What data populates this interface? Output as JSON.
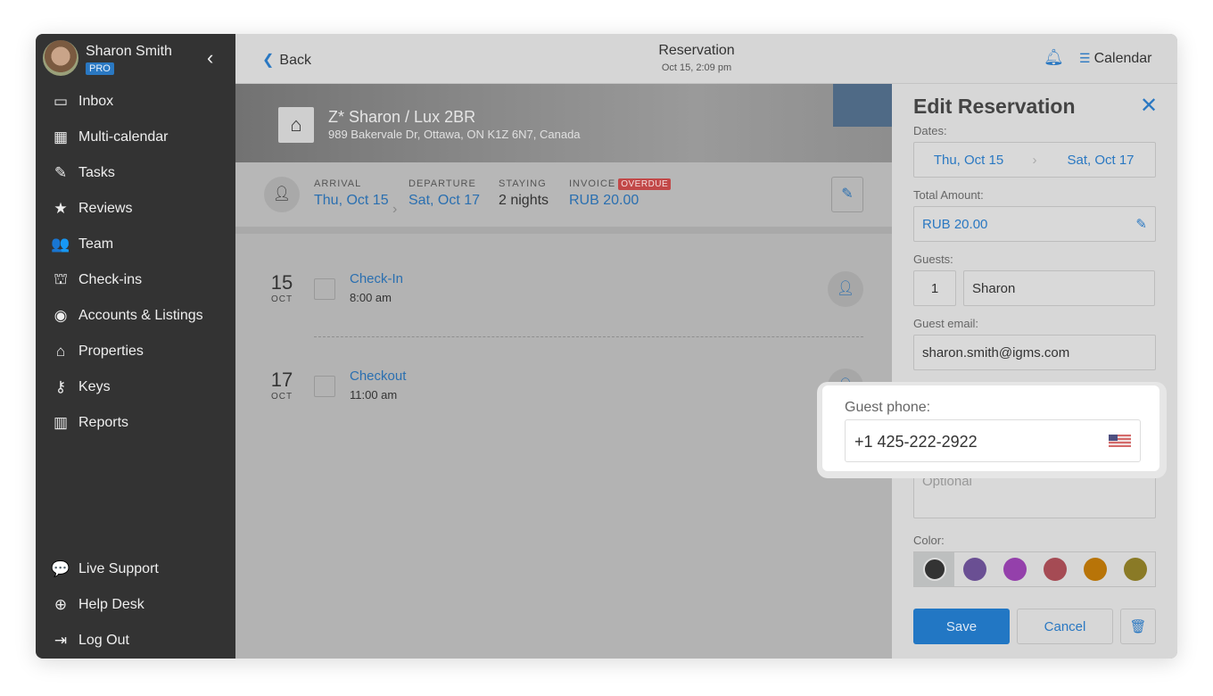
{
  "sidebar": {
    "user": "Sharon Smith",
    "badge": "PRO",
    "items": [
      {
        "label": "Inbox",
        "icon": "inbox-icon",
        "glyph": "▭"
      },
      {
        "label": "Multi-calendar",
        "icon": "calendar-icon",
        "glyph": "▦"
      },
      {
        "label": "Tasks",
        "icon": "tasks-icon",
        "glyph": "✎"
      },
      {
        "label": "Reviews",
        "icon": "star-icon",
        "glyph": "★"
      },
      {
        "label": "Team",
        "icon": "team-icon",
        "glyph": "👥"
      },
      {
        "label": "Check-ins",
        "icon": "bell-desk-icon",
        "glyph": "⛫"
      },
      {
        "label": "Accounts & Listings",
        "icon": "account-icon",
        "glyph": "◉"
      },
      {
        "label": "Properties",
        "icon": "home-icon",
        "glyph": "⌂"
      },
      {
        "label": "Keys",
        "icon": "key-icon",
        "glyph": "⚷"
      },
      {
        "label": "Reports",
        "icon": "reports-icon",
        "glyph": "▥"
      }
    ],
    "bottom": [
      {
        "label": "Live Support",
        "icon": "chat-icon",
        "glyph": "💬"
      },
      {
        "label": "Help Desk",
        "icon": "lifebuoy-icon",
        "glyph": "⊕"
      },
      {
        "label": "Log Out",
        "icon": "logout-icon",
        "glyph": "⇥"
      }
    ]
  },
  "header": {
    "back": "Back",
    "title": "Reservation",
    "subtitle": "Oct 15, 2:09 pm",
    "calendar": "Calendar"
  },
  "property": {
    "name": "Z* Sharon / Lux 2BR",
    "address": "989 Bakervale Dr, Ottawa, ON K1Z 6N7, Canada"
  },
  "summary": {
    "arrival_label": "ARRIVAL",
    "arrival": "Thu, Oct 15",
    "departure_label": "DEPARTURE",
    "departure": "Sat, Oct 17",
    "staying_label": "STAYING",
    "staying": "2 nights",
    "invoice_label": "INVOICE",
    "invoice_badge": "OVERDUE",
    "invoice": "RUB 20.00"
  },
  "events": [
    {
      "day": "15",
      "month": "OCT",
      "title": "Check-In",
      "time": "8:00 am"
    },
    {
      "day": "17",
      "month": "OCT",
      "title": "Checkout",
      "time": "11:00 am"
    }
  ],
  "panel": {
    "title": "Edit Reservation",
    "dates_label": "Dates:",
    "date_from": "Thu, Oct 15",
    "date_to": "Sat, Oct 17",
    "total_label": "Total Amount:",
    "total": "RUB 20.00",
    "guests_label": "Guests:",
    "guests_count": "1",
    "guest_name": "Sharon",
    "email_label": "Guest email:",
    "email": "sharon.smith@igms.com",
    "phone_label": "Guest phone:",
    "phone": "+1 425-222-2922",
    "notes_placeholder": "Optional",
    "color_label": "Color:",
    "colors": [
      "#333333",
      "#6a4f93",
      "#9440ab",
      "#a54b54",
      "#b87408",
      "#8a7a26"
    ],
    "save": "Save",
    "cancel": "Cancel"
  },
  "accent": "#2a78c2"
}
